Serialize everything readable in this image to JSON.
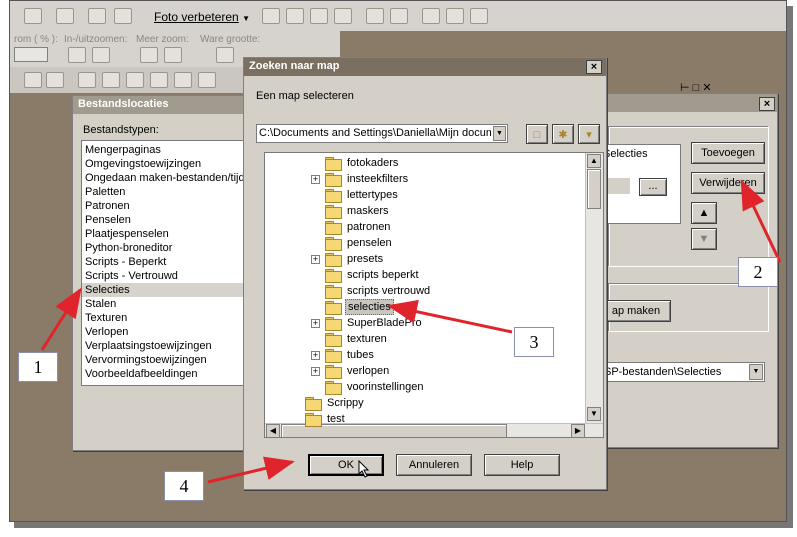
{
  "toolbar": {
    "foto_menu": "Foto verbeteren",
    "zoom_pct_label": "rom ( % ):",
    "zoom_in_out_label": "In-/uitzoomen:",
    "zoom_more_label": "Meer zoom:",
    "actual_size_label": "Ware grootte:"
  },
  "bestandslocaties": {
    "title": "Bestandslocaties",
    "types_label": "Bestandstypen:",
    "items": [
      "Mengerpaginas",
      "Omgevingstoewijzingen",
      "Ongedaan maken-bestanden/tijd",
      "Paletten",
      "Patronen",
      "Penselen",
      "Plaatjespenselen",
      "Python-broneditor",
      "Scripts - Beperkt",
      "Scripts - Vertrouwd",
      "Selecties",
      "Stalen",
      "Texturen",
      "Verlopen",
      "Verplaatsingstoewijzingen",
      "Vervormingstoewijzingen",
      "Voorbeeldafbeeldingen"
    ],
    "selected": "Selecties"
  },
  "right_dialog": {
    "list_entry": "Selecties",
    "browse_button": "...",
    "add_button": "Toevoegen",
    "remove_button": "Verwijderen",
    "make_map_button": "ap maken",
    "path_value": "SP-bestanden\\Selecties",
    "close": "×",
    "panel_controls": "⊢ □ ✕"
  },
  "zoeken": {
    "title": "Zoeken naar map",
    "prompt": "Een map selecteren",
    "path_value": "C:\\Documents and Settings\\Daniella\\Mijn docum",
    "close": "×",
    "tree": [
      {
        "label": "fotokaders",
        "expander": false,
        "indent": 1
      },
      {
        "label": "insteekfilters",
        "expander": true,
        "indent": 1
      },
      {
        "label": "lettertypes",
        "expander": false,
        "indent": 1
      },
      {
        "label": "maskers",
        "expander": false,
        "indent": 1
      },
      {
        "label": "patronen",
        "expander": false,
        "indent": 1
      },
      {
        "label": "penselen",
        "expander": false,
        "indent": 1
      },
      {
        "label": "presets",
        "expander": true,
        "indent": 1
      },
      {
        "label": "scripts beperkt",
        "expander": false,
        "indent": 1
      },
      {
        "label": "scripts vertrouwd",
        "expander": false,
        "indent": 1
      },
      {
        "label": "selecties",
        "expander": false,
        "indent": 1,
        "selected": true
      },
      {
        "label": "SuperBladePro",
        "expander": true,
        "indent": 1
      },
      {
        "label": "texturen",
        "expander": false,
        "indent": 1
      },
      {
        "label": "tubes",
        "expander": true,
        "indent": 1
      },
      {
        "label": "verlopen",
        "expander": true,
        "indent": 1
      },
      {
        "label": "voorinstellingen",
        "expander": false,
        "indent": 1
      },
      {
        "label": "Scrippy",
        "expander": false,
        "indent": 0
      },
      {
        "label": "test",
        "expander": false,
        "indent": 0
      }
    ],
    "ok_button": "OK",
    "cancel_button": "Annuleren",
    "help_button": "Help"
  },
  "callouts": [
    "1",
    "2",
    "3",
    "4"
  ],
  "colors": {
    "arrow": "#e0242c",
    "dialog_bg": "#d4d0c8",
    "title_active": "#7a6f60",
    "title_inactive": "#a19a8f",
    "background": "#8a7a68"
  }
}
